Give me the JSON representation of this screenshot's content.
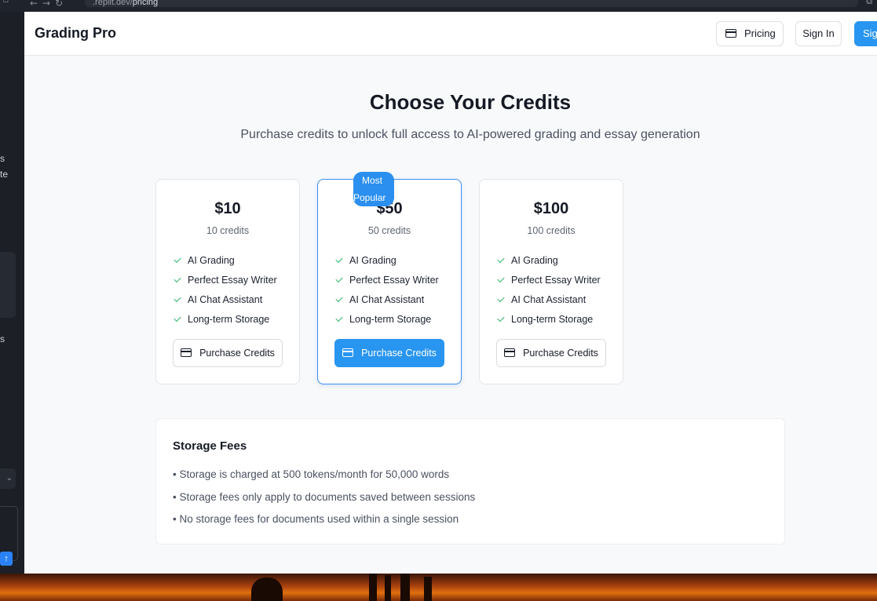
{
  "browser": {
    "url_prefix": ".replit.dev/",
    "url_path": "pricing"
  },
  "left_panel": {
    "fragments": [
      "s",
      "te",
      "s"
    ]
  },
  "app": {
    "brand": "Grading Pro",
    "nav": {
      "pricing": "Pricing",
      "sign_in": "Sign In",
      "sign_up": "Sig"
    }
  },
  "hero": {
    "title": "Choose Your Credits",
    "subtitle": "Purchase credits to unlock full access to AI-powered grading and essay generation"
  },
  "plans": [
    {
      "price": "$10",
      "credits": "10 credits",
      "features": [
        "AI Grading",
        "Perfect Essay Writer",
        "AI Chat Assistant",
        "Long-term Storage"
      ],
      "button": "Purchase Credits"
    },
    {
      "price": "$50",
      "credits": "50 credits",
      "badge_line1": "Most",
      "badge_line2": "Popular",
      "features": [
        "AI Grading",
        "Perfect Essay Writer",
        "AI Chat Assistant",
        "Long-term Storage"
      ],
      "button": "Purchase Credits"
    },
    {
      "price": "$100",
      "credits": "100 credits",
      "features": [
        "AI Grading",
        "Perfect Essay Writer",
        "AI Chat Assistant",
        "Long-term Storage"
      ],
      "button": "Purchase Credits"
    }
  ],
  "storage": {
    "title": "Storage Fees",
    "items": [
      "• Storage is charged at 500 tokens/month for 50,000 words",
      "• Storage fees only apply to documents saved between sessions",
      "• No storage fees for documents used within a single session"
    ]
  },
  "colors": {
    "accent": "#2895f0",
    "check": "#2fb36a",
    "text": "#151a24"
  }
}
